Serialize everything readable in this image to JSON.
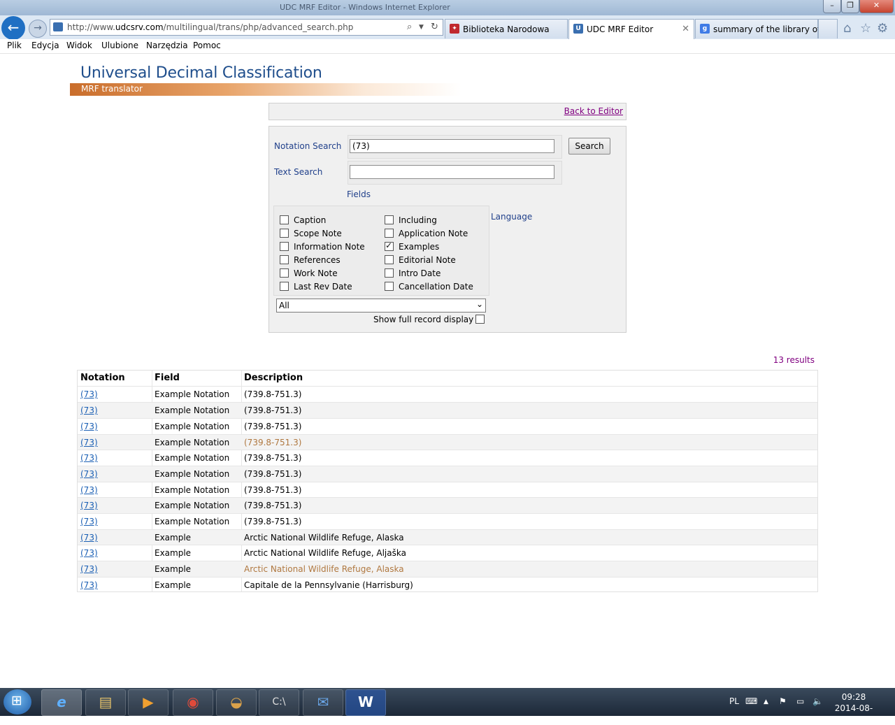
{
  "browser": {
    "window_title": "UDC MRF Editor - Windows Internet Explorer",
    "address_url_prefix": "http://www.",
    "address_url_domain": "udcsrv.com",
    "address_url_path": "/multilingual/trans/php/advanced_search.php",
    "tabs": [
      {
        "label": "Biblioteka Narodowa",
        "icon": "bn-icon",
        "color": "#c0282d"
      },
      {
        "label": "UDC MRF Editor",
        "icon": "udc-icon",
        "color": "#3a6fb0"
      },
      {
        "label": "summary of the library of ...",
        "icon": "google-icon",
        "color": "#3f7be6"
      }
    ],
    "menu": [
      "Plik",
      "Edycja",
      "Widok",
      "Ulubione",
      "Narzędzia",
      "Pomoc"
    ]
  },
  "banner": {
    "title": "Universal Decimal Classification",
    "subtitle": "MRF translator"
  },
  "top_link": "Back to Editor",
  "search": {
    "notation_label": "Notation Search",
    "notation_value": "(73)",
    "text_label": "Text Search",
    "text_value": "",
    "search_button": "Search",
    "fields_label": "Fields",
    "language_label": "Language",
    "fields": [
      {
        "label": "Caption",
        "checked": false
      },
      {
        "label": "Scope Note",
        "checked": false
      },
      {
        "label": "Information Note",
        "checked": false
      },
      {
        "label": "References",
        "checked": false
      },
      {
        "label": "Work Note",
        "checked": false
      },
      {
        "label": "Last Rev Date",
        "checked": false
      },
      {
        "label": "Including",
        "checked": false
      },
      {
        "label": "Application Note",
        "checked": false
      },
      {
        "label": "Examples",
        "checked": true
      },
      {
        "label": "Editorial Note",
        "checked": false
      },
      {
        "label": "Intro Date",
        "checked": false
      },
      {
        "label": "Cancellation Date",
        "checked": false
      }
    ],
    "language_selected": "All",
    "full_record_label": "Show full record display",
    "full_record_checked": false
  },
  "results": {
    "count_text": "13 results",
    "headers": [
      "Notation",
      "Field",
      "Description"
    ],
    "rows": [
      {
        "notation": "(73)",
        "field": "Example Notation",
        "description": "(739.8-751.3)"
      },
      {
        "notation": "(73)",
        "field": "Example Notation",
        "description": "(739.8-751.3)"
      },
      {
        "notation": "(73)",
        "field": "Example Notation",
        "description": "(739.8-751.3)"
      },
      {
        "notation": "(73)",
        "field": "Example Notation",
        "description": "(739.8-751.3)"
      },
      {
        "notation": "(73)",
        "field": "Example Notation",
        "description": "(739.8-751.3)"
      },
      {
        "notation": "(73)",
        "field": "Example Notation",
        "description": "(739.8-751.3)"
      },
      {
        "notation": "(73)",
        "field": "Example Notation",
        "description": "(739.8-751.3)"
      },
      {
        "notation": "(73)",
        "field": "Example Notation",
        "description": "(739.8-751.3)"
      },
      {
        "notation": "(73)",
        "field": "Example Notation",
        "description": "(739.8-751.3)"
      },
      {
        "notation": "(73)",
        "field": "Example",
        "description": "Arctic National Wildlife Refuge, Alaska"
      },
      {
        "notation": "(73)",
        "field": "Example",
        "description": "Arctic National Wildlife Refuge, Aljaška"
      },
      {
        "notation": "(73)",
        "field": "Example",
        "description": "Arctic National Wildlife Refuge, Alaska"
      },
      {
        "notation": "(73)",
        "field": "Example",
        "description": "Capitale de la Pennsylvanie (Harrisburg)"
      }
    ]
  },
  "taskbar": {
    "apps": [
      "internet-explorer-icon",
      "file-explorer-icon",
      "media-player-icon",
      "chrome-icon",
      "burger-app-icon",
      "command-prompt-icon",
      "thunderbird-icon",
      "word-icon"
    ],
    "language": "PL",
    "time": "09:28",
    "date": "2014-08-29"
  }
}
